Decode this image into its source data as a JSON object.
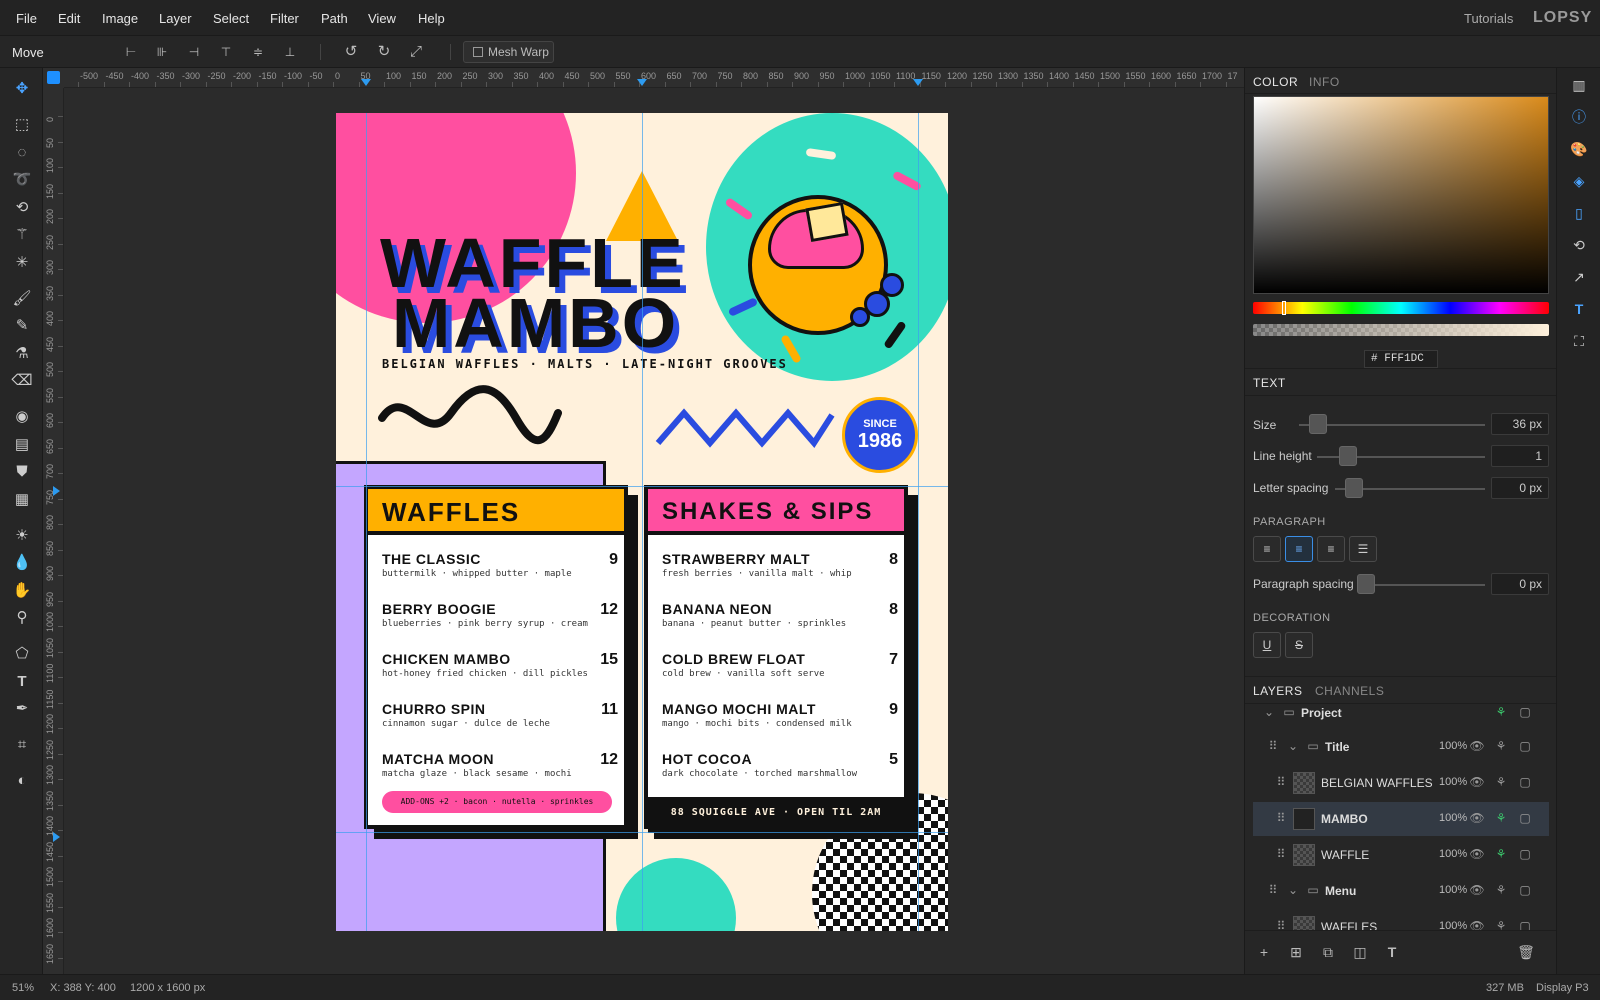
{
  "menubar": {
    "items": [
      "File",
      "Edit",
      "Image",
      "Layer",
      "Select",
      "Filter",
      "Path",
      "View",
      "Help"
    ],
    "tutorials": "Tutorials",
    "logo": "LOPSY"
  },
  "options": {
    "tool_name": "Move",
    "mesh_warp": "Mesh Warp"
  },
  "rulers": {
    "top": [
      "-500",
      "-450",
      "-400",
      "-350",
      "-300",
      "-250",
      "-200",
      "-150",
      "-100",
      "-50",
      "0",
      "50",
      "100",
      "150",
      "200",
      "250",
      "300",
      "350",
      "400",
      "450",
      "500",
      "550",
      "600",
      "650",
      "700",
      "750",
      "800",
      "850",
      "900",
      "950",
      "1000",
      "1050",
      "1100",
      "1150",
      "1200",
      "1250",
      "1300",
      "1350",
      "1400",
      "1450",
      "1500",
      "1550",
      "1600",
      "1650",
      "1700",
      "17"
    ],
    "left": [
      "0",
      "50",
      "100",
      "150",
      "200",
      "250",
      "300",
      "350",
      "400",
      "450",
      "500",
      "550",
      "600",
      "650",
      "700",
      "750",
      "800",
      "850",
      "900",
      "950",
      "1000",
      "1050",
      "1100",
      "1150",
      "1200",
      "1250",
      "1300",
      "1350",
      "1400",
      "1450",
      "1500",
      "1550",
      "1600",
      "1650"
    ]
  },
  "poster": {
    "title_line1": "WAFFLE",
    "title_line2": "MAMBO",
    "tagline": "BELGIAN WAFFLES · MALTS · LATE-NIGHT GROOVES",
    "since_small": "SINCE",
    "since_year": "1986",
    "waffles": {
      "heading": "WAFFLES",
      "items": [
        {
          "name": "THE CLASSIC",
          "price": "9",
          "desc": "buttermilk · whipped butter · maple"
        },
        {
          "name": "BERRY BOOGIE",
          "price": "12",
          "desc": "blueberries · pink berry syrup · cream"
        },
        {
          "name": "CHICKEN MAMBO",
          "price": "15",
          "desc": "hot-honey fried chicken · dill pickles"
        },
        {
          "name": "CHURRO SPIN",
          "price": "11",
          "desc": "cinnamon sugar · dulce de leche"
        },
        {
          "name": "MATCHA MOON",
          "price": "12",
          "desc": "matcha glaze · black sesame · mochi"
        }
      ],
      "addons": "ADD-ONS +2 · bacon · nutella · sprinkles"
    },
    "shakes": {
      "heading": "SHAKES & SIPS",
      "items": [
        {
          "name": "STRAWBERRY MALT",
          "price": "8",
          "desc": "fresh berries · vanilla malt · whip"
        },
        {
          "name": "BANANA NEON",
          "price": "8",
          "desc": "banana · peanut butter · sprinkles"
        },
        {
          "name": "COLD BREW FLOAT",
          "price": "7",
          "desc": "cold brew · vanilla soft serve"
        },
        {
          "name": "MANGO MOCHI MALT",
          "price": "9",
          "desc": "mango · mochi bits · condensed milk"
        },
        {
          "name": "HOT COCOA",
          "price": "5",
          "desc": "dark chocolate · torched marshmallow"
        }
      ],
      "address": "88 SQUIGGLE AVE · OPEN TIL 2AM"
    },
    "colors": {
      "bg": "#FFF1DC",
      "pink": "#FF4FA0",
      "teal": "#34DCC0",
      "yellow": "#FFB000",
      "blue": "#2A4CE0",
      "purple": "#C4A6FF"
    }
  },
  "color_panel": {
    "tab_color": "COLOR",
    "tab_info": "INFO",
    "hex_prefix": "#",
    "hex": "FFF1DC"
  },
  "text_panel": {
    "tab": "TEXT",
    "size_label": "Size",
    "size_value": "36 px",
    "line_height_label": "Line height",
    "line_height_value": "1",
    "letter_spacing_label": "Letter spacing",
    "letter_spacing_value": "0 px",
    "paragraph_label": "PARAGRAPH",
    "paragraph_spacing_label": "Paragraph spacing",
    "paragraph_spacing_value": "0 px",
    "decoration_label": "DECORATION",
    "underline": "U",
    "strike": "S"
  },
  "layers_panel": {
    "tab_layers": "LAYERS",
    "tab_channels": "CHANNELS",
    "rows": [
      {
        "name": "Project",
        "pct": ""
      },
      {
        "name": "Title",
        "pct": "100%"
      },
      {
        "name": "BELGIAN WAFFLES",
        "pct": "100%"
      },
      {
        "name": "MAMBO",
        "pct": "100%"
      },
      {
        "name": "WAFFLE",
        "pct": "100%"
      },
      {
        "name": "Menu",
        "pct": "100%"
      },
      {
        "name": "WAFFLES",
        "pct": "100%"
      }
    ]
  },
  "status": {
    "zoom": "51%",
    "coords": "X: 388 Y: 400",
    "dims": "1200 x 1600 px",
    "memory": "327 MB",
    "profile": "Display P3"
  }
}
